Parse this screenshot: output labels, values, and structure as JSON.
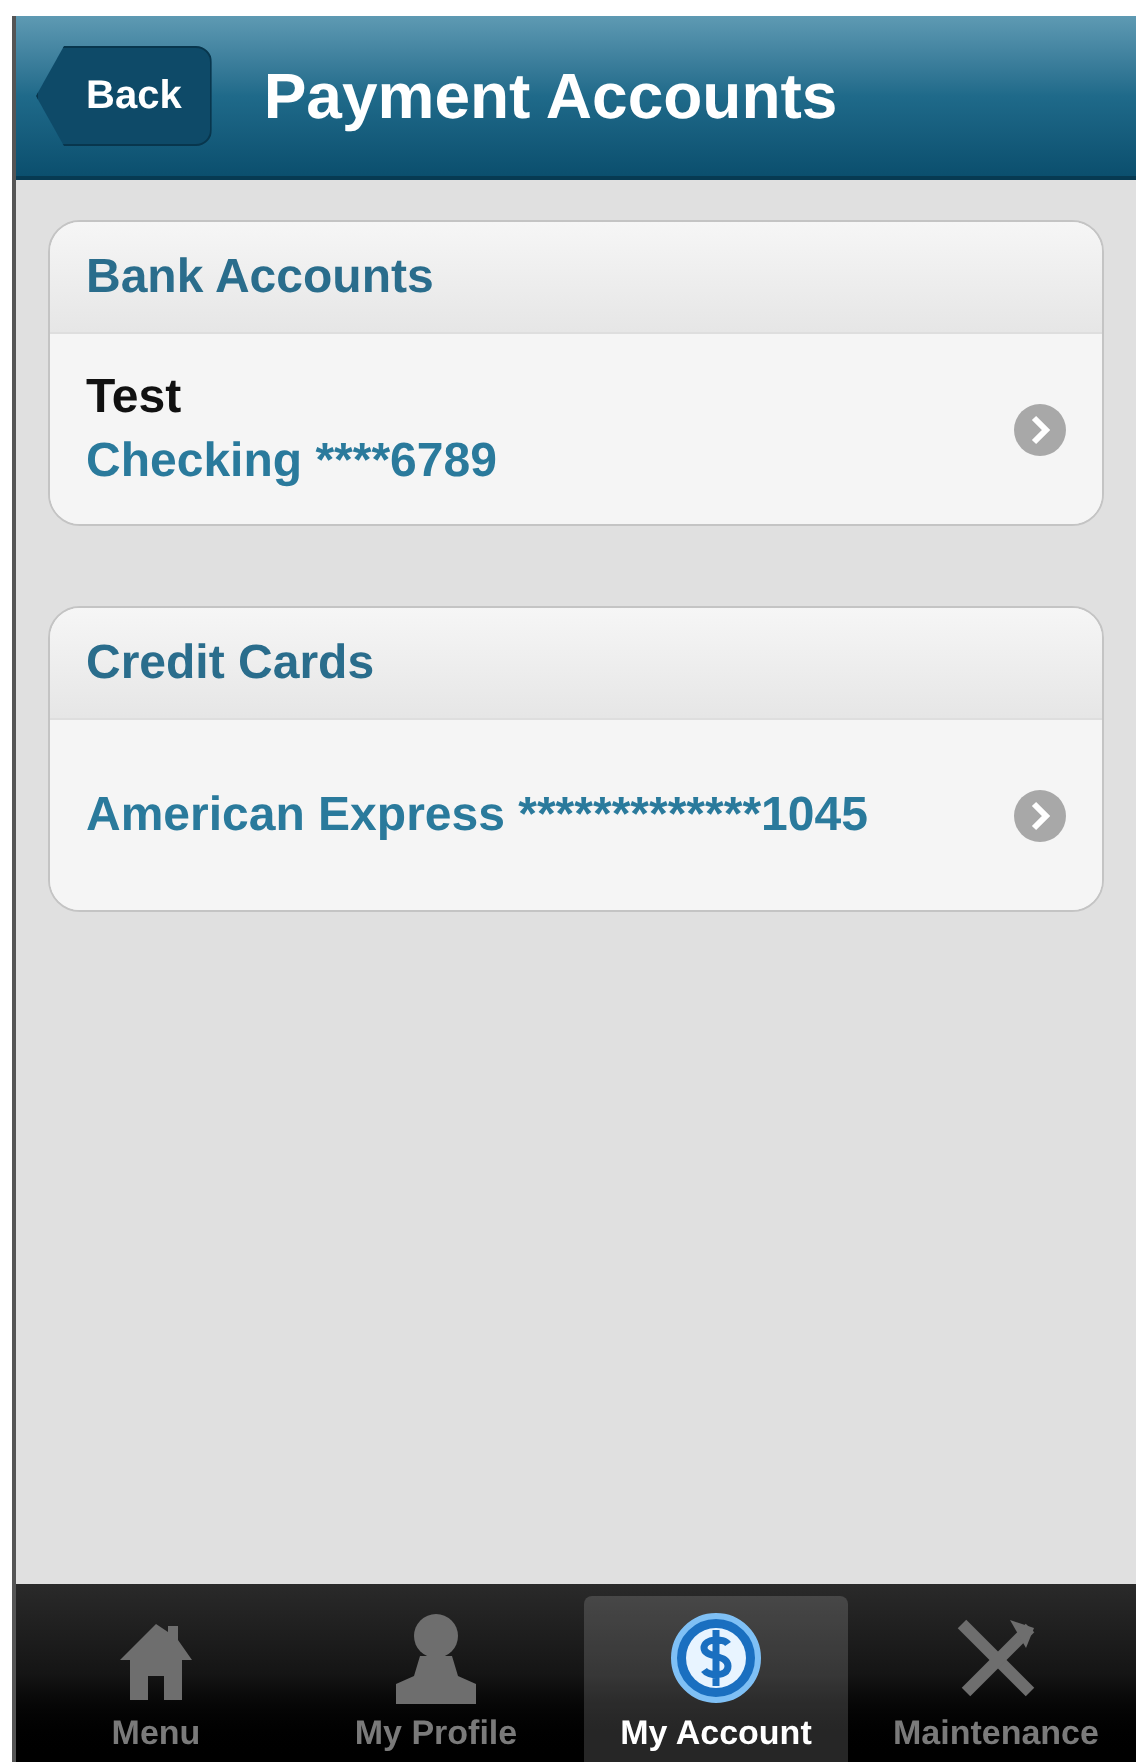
{
  "header": {
    "back": "Back",
    "title": "Payment Accounts"
  },
  "sections": [
    {
      "title": "Bank Accounts",
      "items": [
        {
          "name": "Test",
          "detail": "Checking ****6789"
        }
      ]
    },
    {
      "title": "Credit Cards",
      "items": [
        {
          "detail": "American Express *************1045"
        }
      ]
    }
  ],
  "tabs": [
    {
      "label": "Menu",
      "kind": "home",
      "selected": false
    },
    {
      "label": "My Profile",
      "kind": "person",
      "selected": false
    },
    {
      "label": "My Account",
      "kind": "money",
      "selected": true
    },
    {
      "label": "Maintenance",
      "kind": "tools",
      "selected": false
    }
  ]
}
